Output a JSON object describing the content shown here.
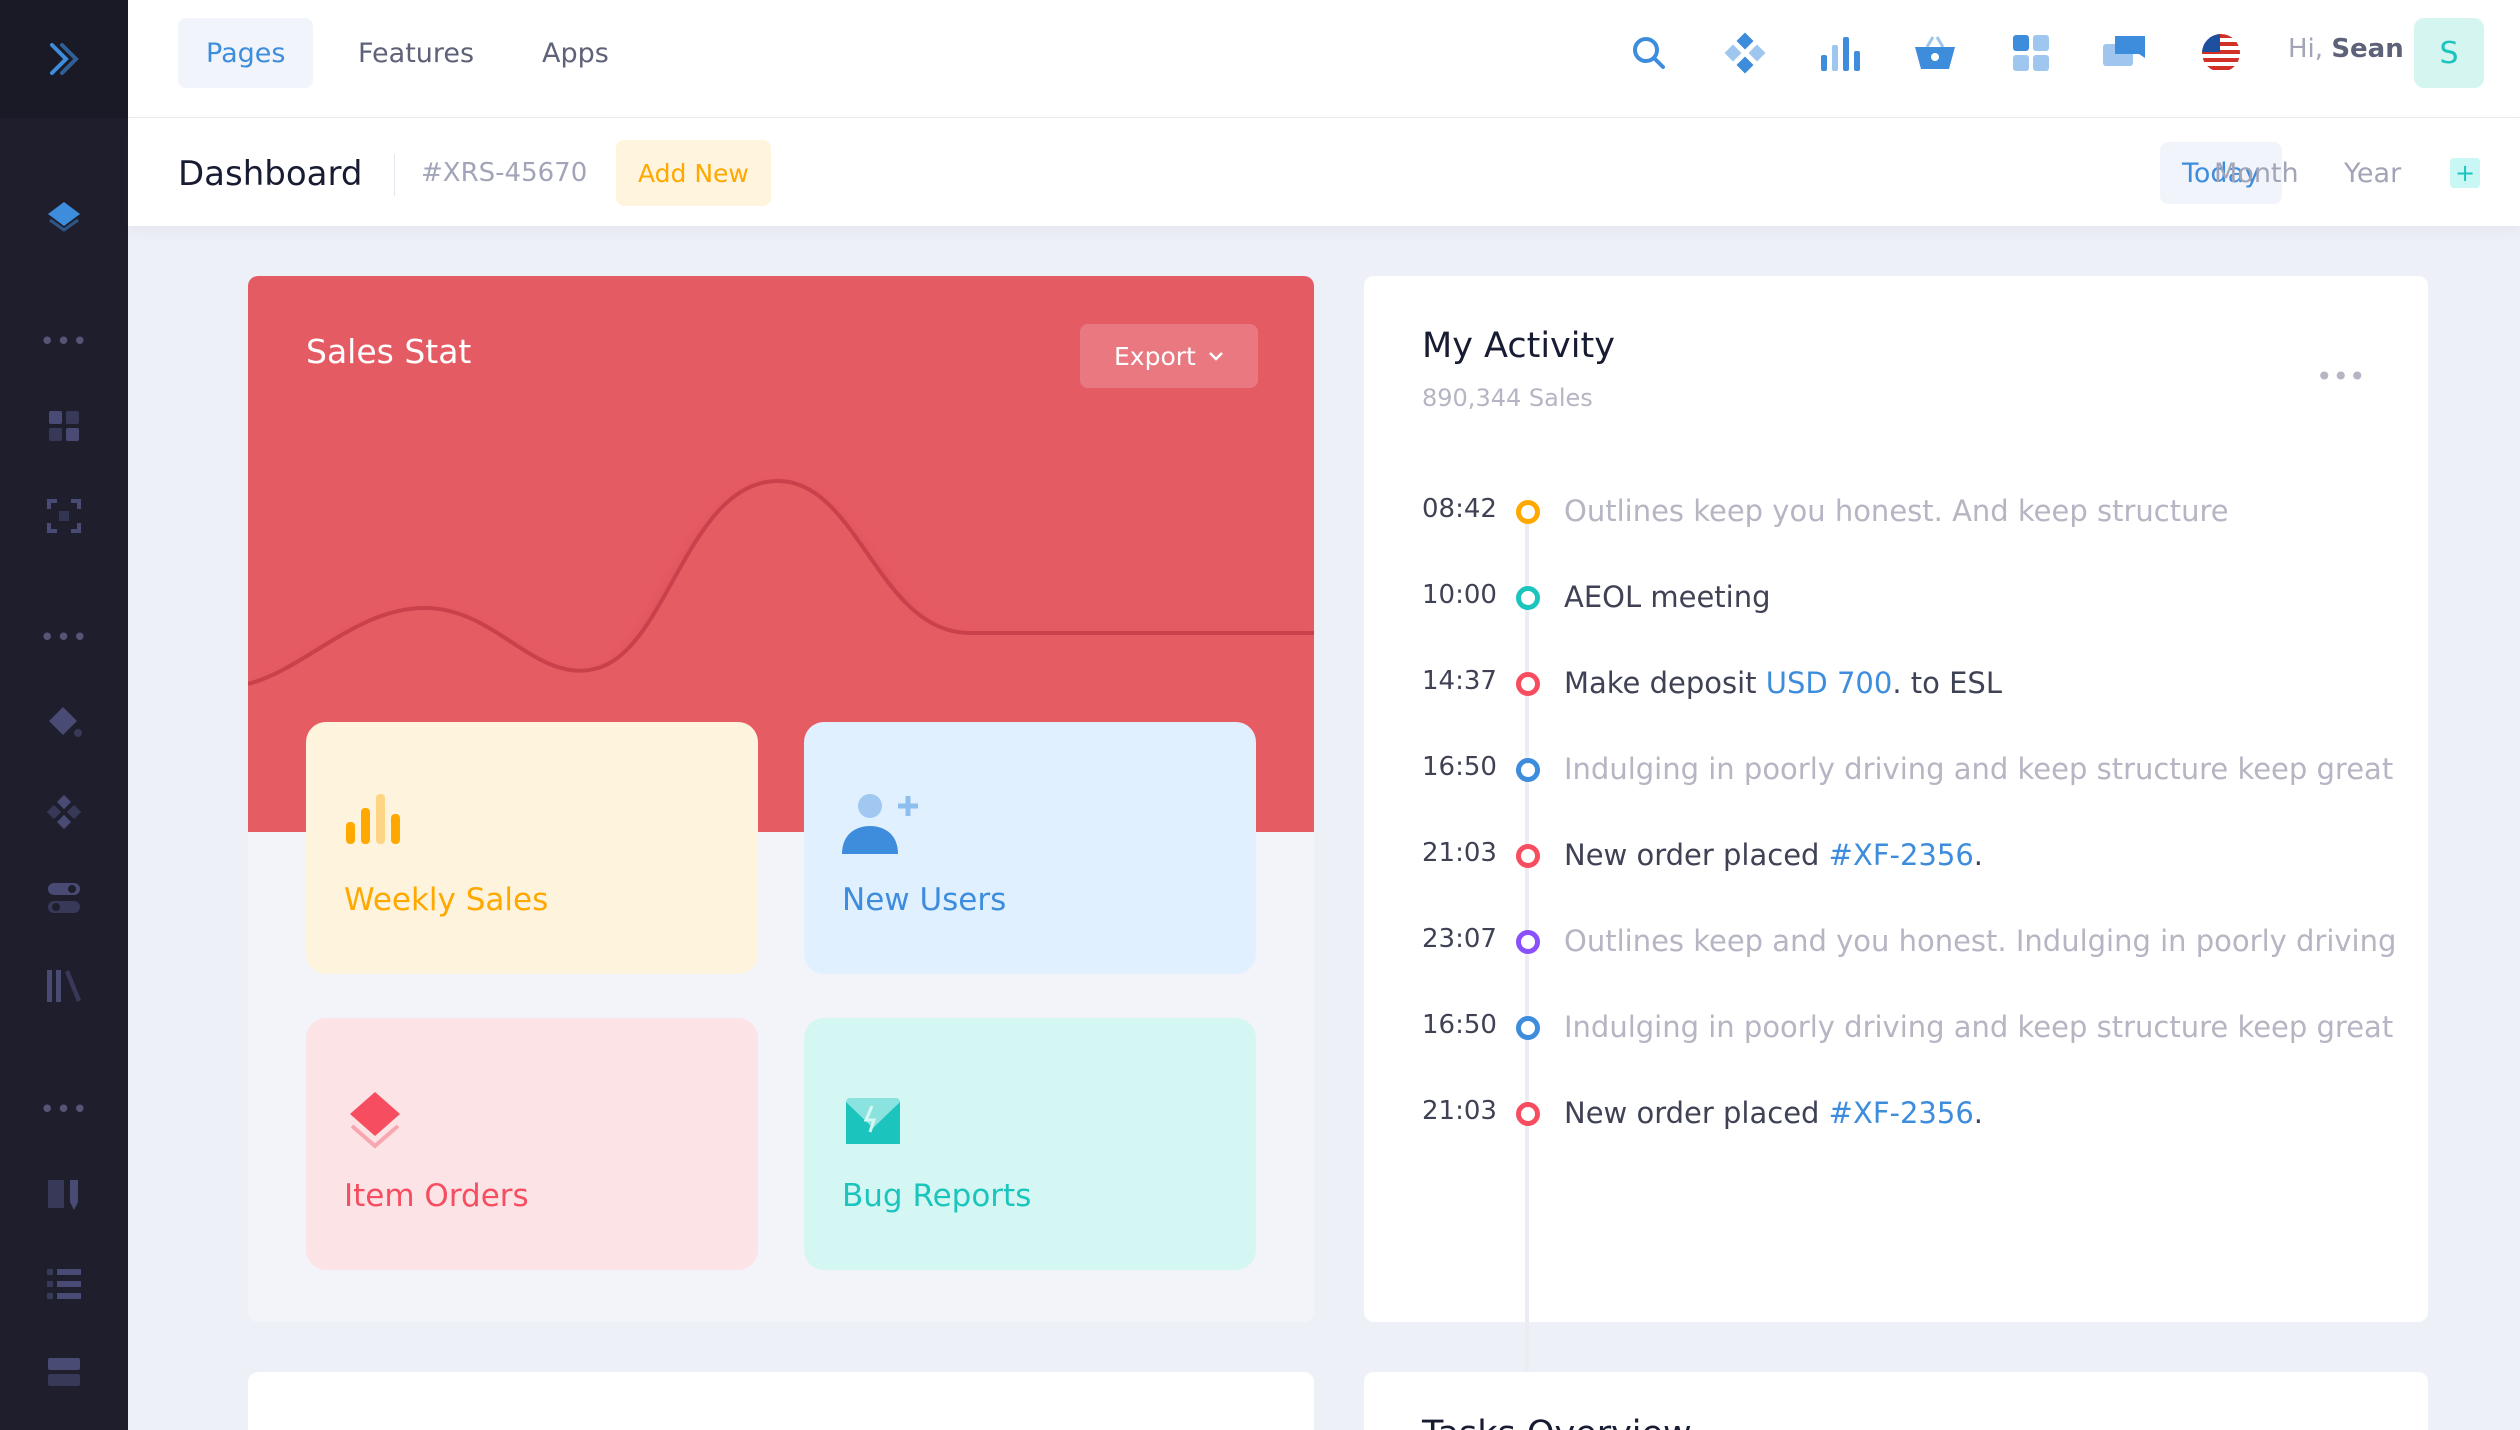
{
  "header": {
    "nav": [
      "Pages",
      "Features",
      "Apps"
    ],
    "greeting_prefix": "Hi,",
    "user_name": "Sean",
    "avatar_initial": "S",
    "icons": [
      "search-icon",
      "puzzle-icon",
      "bar-chart-icon",
      "basket-icon",
      "apps-grid-icon",
      "chat-icon",
      "flag-us-icon"
    ]
  },
  "subheader": {
    "title": "Dashboard",
    "code": "#XRS-45670",
    "add_new": "Add New",
    "ranges": [
      "Today",
      "Month",
      "Year"
    ],
    "active_range": "Today"
  },
  "sales": {
    "title": "Sales Stat",
    "export_label": "Export",
    "tiles": [
      {
        "label": "Weekly Sales",
        "color": "#ffa800",
        "icon": "bar-chart-icon"
      },
      {
        "label": "New Users",
        "color": "#3e8ddd",
        "icon": "add-user-icon"
      },
      {
        "label": "Item Orders",
        "color": "#f64e60",
        "icon": "layers-icon"
      },
      {
        "label": "Bug Reports",
        "color": "#1bc5bd",
        "icon": "mail-icon"
      }
    ]
  },
  "activity": {
    "title": "My Activity",
    "subtitle": "890,344 Sales",
    "items": [
      {
        "time": "08:42",
        "dot": "#ffa800",
        "parts": [
          "Outlines keep you honest. And keep structure"
        ],
        "style": "muted"
      },
      {
        "time": "10:00",
        "dot": "#1bc5bd",
        "parts": [
          "AEOL meeting"
        ],
        "style": "strong"
      },
      {
        "time": "14:37",
        "dot": "#f64e60",
        "parts": [
          "Make deposit ",
          "USD 700",
          ". to ESL"
        ],
        "style": "strong"
      },
      {
        "time": "16:50",
        "dot": "#3e8ddd",
        "parts": [
          "Indulging in poorly driving and keep structure keep great"
        ],
        "style": "muted"
      },
      {
        "time": "21:03",
        "dot": "#f64e60",
        "parts": [
          "New order placed ",
          "#XF-2356",
          "."
        ],
        "style": "strong"
      },
      {
        "time": "23:07",
        "dot": "#8950fc",
        "parts": [
          "Outlines keep and you honest. Indulging in poorly driving"
        ],
        "style": "muted"
      },
      {
        "time": "16:50",
        "dot": "#3e8ddd",
        "parts": [
          "Indulging in poorly driving and keep structure keep great"
        ],
        "style": "muted"
      },
      {
        "time": "21:03",
        "dot": "#f64e60",
        "parts": [
          "New order placed ",
          "#XF-2356",
          "."
        ],
        "style": "strong"
      }
    ]
  },
  "tasks": {
    "title": "Tasks Overview"
  },
  "colors": {
    "sidebar": "#1e1e2d",
    "accent": "#3e8ddd",
    "sales_bg": "#e55b64"
  }
}
